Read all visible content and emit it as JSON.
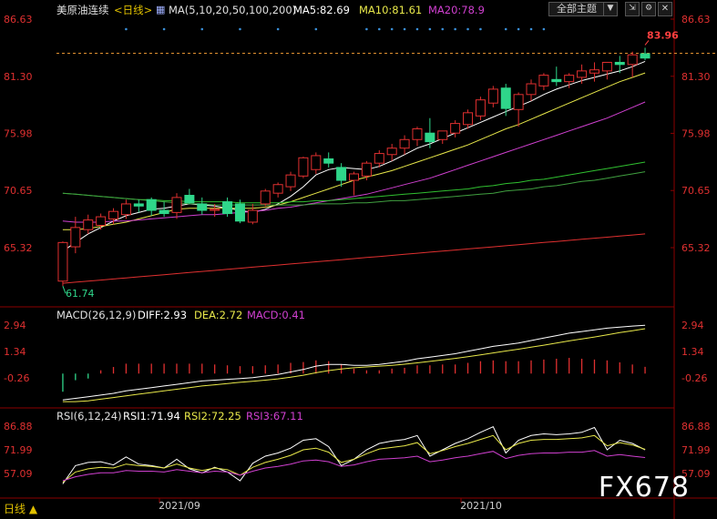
{
  "header": {
    "symbol": "美原油连续",
    "period": "<日线>",
    "ma_params": "MA(5,10,20,50,100,200)",
    "ma5": "MA5:82.69",
    "ma10": "MA10:81.61",
    "ma20": "MA20:78.9",
    "theme_button": "全部主题",
    "dropdown_icon": "triangle-down-icon",
    "colors": {
      "ma5": "#ffffff",
      "ma10": "#e8e84a",
      "ma20": "#d040d0",
      "ma50": "#30c030",
      "ma100": "#40a040",
      "ma200": "#e03030",
      "up": "#e03030",
      "down": "#2fd68a"
    }
  },
  "macd_header": {
    "label": "MACD(26,12,9)",
    "diff": "DIFF:2.93",
    "dea": "DEA:2.72",
    "macd": "MACD:0.41"
  },
  "rsi_header": {
    "label": "RSI(6,12,24)",
    "rsi1": "RSI1:71.94",
    "rsi2": "RSI2:72.25",
    "rsi3": "RSI3:67.11"
  },
  "footer": {
    "period_button": "日线",
    "dates": [
      "2021/09",
      "2021/10"
    ],
    "watermark": "FX678"
  },
  "chart_data": [
    {
      "type": "candlestick",
      "title": "美原油连续 日线",
      "y_ticks": [
        "86.63",
        "81.30",
        "75.98",
        "70.65",
        "65.32"
      ],
      "ylim": [
        61.0,
        87.5
      ],
      "annotations": {
        "high": "83.96",
        "low": "61.74"
      },
      "ohlc": [
        [
          62.2,
          65.9,
          61.74,
          65.8
        ],
        [
          65.4,
          68.2,
          64.8,
          67.2
        ],
        [
          67.0,
          68.4,
          66.6,
          67.9
        ],
        [
          67.4,
          68.5,
          67.0,
          68.2
        ],
        [
          68.0,
          69.0,
          67.5,
          68.7
        ],
        [
          68.4,
          69.8,
          68.0,
          69.4
        ],
        [
          69.4,
          69.8,
          68.6,
          69.2
        ],
        [
          69.8,
          70.0,
          68.3,
          68.8
        ],
        [
          68.8,
          69.6,
          68.2,
          68.5
        ],
        [
          68.6,
          70.4,
          68.0,
          70.0
        ],
        [
          70.2,
          70.8,
          69.4,
          69.5
        ],
        [
          69.4,
          70.0,
          68.4,
          68.8
        ],
        [
          68.8,
          69.4,
          68.2,
          68.9
        ],
        [
          69.6,
          70.0,
          68.2,
          68.5
        ],
        [
          69.4,
          69.8,
          67.6,
          67.8
        ],
        [
          67.7,
          69.4,
          67.5,
          68.8
        ],
        [
          69.4,
          70.8,
          69.2,
          70.6
        ],
        [
          70.4,
          71.4,
          70.0,
          71.2
        ],
        [
          71.0,
          72.4,
          70.6,
          72.1
        ],
        [
          72.0,
          73.8,
          71.8,
          73.7
        ],
        [
          72.6,
          74.2,
          72.2,
          73.9
        ],
        [
          73.6,
          74.2,
          72.8,
          73.2
        ],
        [
          72.8,
          73.2,
          71.0,
          71.6
        ],
        [
          71.6,
          72.4,
          70.2,
          72.2
        ],
        [
          72.0,
          73.4,
          71.6,
          73.2
        ],
        [
          73.2,
          74.4,
          72.8,
          74.1
        ],
        [
          74.0,
          75.0,
          73.4,
          74.6
        ],
        [
          74.6,
          75.8,
          74.0,
          75.4
        ],
        [
          75.4,
          76.6,
          74.8,
          76.4
        ],
        [
          76.0,
          77.4,
          74.6,
          75.2
        ],
        [
          75.4,
          76.2,
          75.0,
          76.2
        ],
        [
          76.0,
          77.2,
          75.6,
          76.9
        ],
        [
          76.8,
          78.2,
          76.4,
          77.9
        ],
        [
          77.6,
          79.4,
          77.2,
          79.1
        ],
        [
          78.8,
          80.4,
          78.4,
          80.1
        ],
        [
          80.2,
          80.6,
          77.6,
          78.3
        ],
        [
          78.2,
          79.8,
          76.6,
          79.6
        ],
        [
          79.6,
          81.0,
          79.0,
          80.6
        ],
        [
          80.4,
          81.6,
          80.0,
          81.4
        ],
        [
          81.0,
          82.2,
          80.4,
          80.8
        ],
        [
          80.8,
          81.6,
          80.2,
          81.4
        ],
        [
          81.2,
          82.4,
          80.6,
          81.8
        ],
        [
          81.6,
          82.6,
          80.8,
          81.9
        ],
        [
          81.8,
          82.6,
          81.0,
          82.6
        ],
        [
          82.6,
          83.2,
          81.6,
          82.4
        ],
        [
          82.4,
          83.6,
          81.2,
          83.3
        ],
        [
          83.4,
          83.96,
          82.8,
          83.0
        ]
      ],
      "series": [
        {
          "name": "MA5",
          "values": [
            65.0,
            65.8,
            66.6,
            67.2,
            67.8,
            68.3,
            68.6,
            68.9,
            69.0,
            69.2,
            69.4,
            69.3,
            69.2,
            69.0,
            68.8,
            68.6,
            68.9,
            69.4,
            70.1,
            71.0,
            72.1,
            72.6,
            72.8,
            72.7,
            72.6,
            72.9,
            73.4,
            74.0,
            74.6,
            75.0,
            75.5,
            76.0,
            76.5,
            77.0,
            77.5,
            78.0,
            78.5,
            79.0,
            79.6,
            80.1,
            80.5,
            80.9,
            81.2,
            81.5,
            81.8,
            82.2,
            82.69
          ]
        },
        {
          "name": "MA10",
          "values": [
            67.0,
            67.0,
            67.1,
            67.3,
            67.5,
            67.7,
            68.0,
            68.3,
            68.6,
            68.9,
            69.0,
            69.0,
            69.0,
            69.0,
            69.0,
            69.0,
            69.1,
            69.3,
            69.6,
            70.0,
            70.4,
            70.8,
            71.2,
            71.6,
            71.9,
            72.2,
            72.5,
            72.9,
            73.3,
            73.7,
            74.1,
            74.5,
            74.9,
            75.4,
            75.9,
            76.4,
            76.8,
            77.3,
            77.8,
            78.3,
            78.8,
            79.3,
            79.8,
            80.3,
            80.8,
            81.2,
            81.61
          ]
        },
        {
          "name": "MA20",
          "values": [
            67.8,
            67.7,
            67.7,
            67.7,
            67.8,
            67.8,
            67.9,
            68.0,
            68.1,
            68.2,
            68.3,
            68.4,
            68.4,
            68.5,
            68.6,
            68.7,
            68.8,
            69.0,
            69.1,
            69.3,
            69.5,
            69.7,
            69.9,
            70.1,
            70.3,
            70.6,
            70.9,
            71.2,
            71.5,
            71.8,
            72.2,
            72.6,
            73.0,
            73.4,
            73.8,
            74.2,
            74.6,
            75.0,
            75.4,
            75.8,
            76.2,
            76.6,
            77.0,
            77.4,
            77.9,
            78.4,
            78.9
          ]
        },
        {
          "name": "MA50",
          "values": [
            70.4,
            70.3,
            70.2,
            70.1,
            70.0,
            69.9,
            69.8,
            69.8,
            69.7,
            69.7,
            69.6,
            69.6,
            69.6,
            69.6,
            69.5,
            69.5,
            69.5,
            69.5,
            69.6,
            69.6,
            69.7,
            69.7,
            69.8,
            69.9,
            70.0,
            70.1,
            70.2,
            70.3,
            70.4,
            70.5,
            70.6,
            70.7,
            70.8,
            71.0,
            71.1,
            71.3,
            71.4,
            71.6,
            71.7,
            71.9,
            72.1,
            72.3,
            72.5,
            72.7,
            72.9,
            73.1,
            73.3
          ]
        },
        {
          "name": "MA100",
          "values": [
            70.4,
            70.3,
            70.2,
            70.1,
            70.0,
            69.9,
            69.8,
            69.7,
            69.6,
            69.5,
            69.4,
            69.4,
            69.3,
            69.3,
            69.3,
            69.3,
            69.3,
            69.3,
            69.3,
            69.3,
            69.4,
            69.4,
            69.4,
            69.5,
            69.5,
            69.6,
            69.7,
            69.7,
            69.8,
            69.9,
            70.0,
            70.1,
            70.2,
            70.3,
            70.4,
            70.6,
            70.7,
            70.8,
            71.0,
            71.1,
            71.3,
            71.5,
            71.6,
            71.8,
            72.0,
            72.2,
            72.4
          ]
        },
        {
          "name": "MA200",
          "values": [
            62.0,
            62.1,
            62.2,
            62.3,
            62.4,
            62.5,
            62.6,
            62.7,
            62.8,
            62.9,
            63.0,
            63.1,
            63.2,
            63.3,
            63.4,
            63.5,
            63.6,
            63.7,
            63.8,
            63.9,
            64.0,
            64.1,
            64.2,
            64.3,
            64.4,
            64.5,
            64.6,
            64.7,
            64.8,
            64.9,
            65.0,
            65.1,
            65.2,
            65.3,
            65.4,
            65.5,
            65.6,
            65.7,
            65.8,
            65.9,
            66.0,
            66.1,
            66.2,
            66.3,
            66.4,
            66.5,
            66.6
          ]
        }
      ]
    },
    {
      "type": "line",
      "title": "MACD(26,12,9)",
      "y_ticks": [
        "2.94",
        "1.34",
        "-0.26"
      ],
      "ylim": [
        -1.8,
        3.3
      ],
      "series": [
        {
          "name": "DIFF",
          "values": [
            -1.6,
            -1.5,
            -1.4,
            -1.3,
            -1.2,
            -1.05,
            -0.95,
            -0.85,
            -0.75,
            -0.65,
            -0.55,
            -0.45,
            -0.4,
            -0.35,
            -0.3,
            -0.25,
            -0.15,
            -0.05,
            0.1,
            0.25,
            0.45,
            0.55,
            0.55,
            0.5,
            0.5,
            0.55,
            0.65,
            0.75,
            0.9,
            1.0,
            1.1,
            1.2,
            1.35,
            1.5,
            1.65,
            1.75,
            1.85,
            2.0,
            2.15,
            2.3,
            2.45,
            2.55,
            2.65,
            2.75,
            2.82,
            2.88,
            2.93
          ]
        },
        {
          "name": "DEA",
          "values": [
            -1.7,
            -1.7,
            -1.65,
            -1.55,
            -1.45,
            -1.35,
            -1.25,
            -1.15,
            -1.05,
            -0.95,
            -0.85,
            -0.75,
            -0.68,
            -0.6,
            -0.53,
            -0.47,
            -0.4,
            -0.32,
            -0.22,
            -0.1,
            0.05,
            0.18,
            0.28,
            0.35,
            0.4,
            0.45,
            0.5,
            0.57,
            0.65,
            0.74,
            0.83,
            0.92,
            1.02,
            1.13,
            1.25,
            1.37,
            1.48,
            1.6,
            1.72,
            1.85,
            1.98,
            2.1,
            2.22,
            2.35,
            2.48,
            2.6,
            2.72
          ]
        },
        {
          "name": "MACD",
          "values": [
            -1.1,
            -0.4,
            -0.3,
            0.2,
            0.4,
            0.6,
            0.6,
            0.6,
            0.6,
            0.6,
            0.6,
            0.6,
            0.55,
            0.5,
            0.45,
            0.45,
            0.5,
            0.55,
            0.65,
            0.7,
            0.8,
            0.75,
            0.55,
            0.3,
            0.2,
            0.2,
            0.3,
            0.35,
            0.5,
            0.5,
            0.55,
            0.55,
            0.65,
            0.75,
            0.8,
            0.75,
            0.75,
            0.8,
            0.85,
            0.9,
            0.95,
            0.9,
            0.85,
            0.8,
            0.68,
            0.55,
            0.41
          ]
        }
      ]
    },
    {
      "type": "line",
      "title": "RSI(6,12,24)",
      "y_ticks": [
        "86.88",
        "71.99",
        "57.09"
      ],
      "ylim": [
        50.0,
        92.0
      ],
      "series": [
        {
          "name": "RSI1",
          "values": [
            50.5,
            62.0,
            64.0,
            64.5,
            62.5,
            67.5,
            63.0,
            62.0,
            60.5,
            66.0,
            60.0,
            57.5,
            61.0,
            58.0,
            52.5,
            63.5,
            68.0,
            70.0,
            73.0,
            78.0,
            79.0,
            74.0,
            62.0,
            66.0,
            72.0,
            76.0,
            77.5,
            78.5,
            81.0,
            68.0,
            72.0,
            76.0,
            79.0,
            83.0,
            86.5,
            70.0,
            78.0,
            81.0,
            82.0,
            81.5,
            82.0,
            83.0,
            86.0,
            72.0,
            78.0,
            76.0,
            71.94
          ]
        },
        {
          "name": "RSI2",
          "values": [
            51.5,
            58.0,
            60.0,
            61.0,
            60.5,
            63.0,
            62.0,
            61.5,
            60.5,
            63.0,
            60.5,
            59.0,
            60.5,
            59.5,
            56.0,
            61.0,
            64.0,
            66.0,
            68.5,
            72.0,
            73.0,
            70.5,
            64.0,
            66.0,
            69.5,
            72.5,
            73.5,
            74.5,
            76.5,
            69.5,
            71.5,
            74.0,
            76.0,
            78.5,
            81.0,
            72.0,
            76.0,
            78.0,
            78.5,
            78.5,
            79.0,
            79.5,
            81.0,
            74.5,
            76.5,
            75.0,
            72.25
          ]
        },
        {
          "name": "RSI3",
          "values": [
            52.5,
            55.0,
            56.5,
            57.5,
            57.5,
            59.0,
            58.5,
            58.5,
            58.0,
            59.5,
            58.5,
            57.5,
            58.5,
            58.0,
            56.0,
            58.5,
            60.5,
            61.5,
            63.0,
            65.0,
            65.5,
            64.5,
            61.5,
            62.5,
            64.5,
            66.0,
            66.5,
            67.0,
            68.0,
            64.5,
            65.5,
            67.0,
            68.0,
            69.5,
            71.0,
            66.5,
            68.5,
            69.5,
            70.0,
            70.0,
            70.5,
            70.5,
            71.5,
            68.0,
            69.0,
            68.0,
            67.11
          ]
        }
      ]
    }
  ]
}
